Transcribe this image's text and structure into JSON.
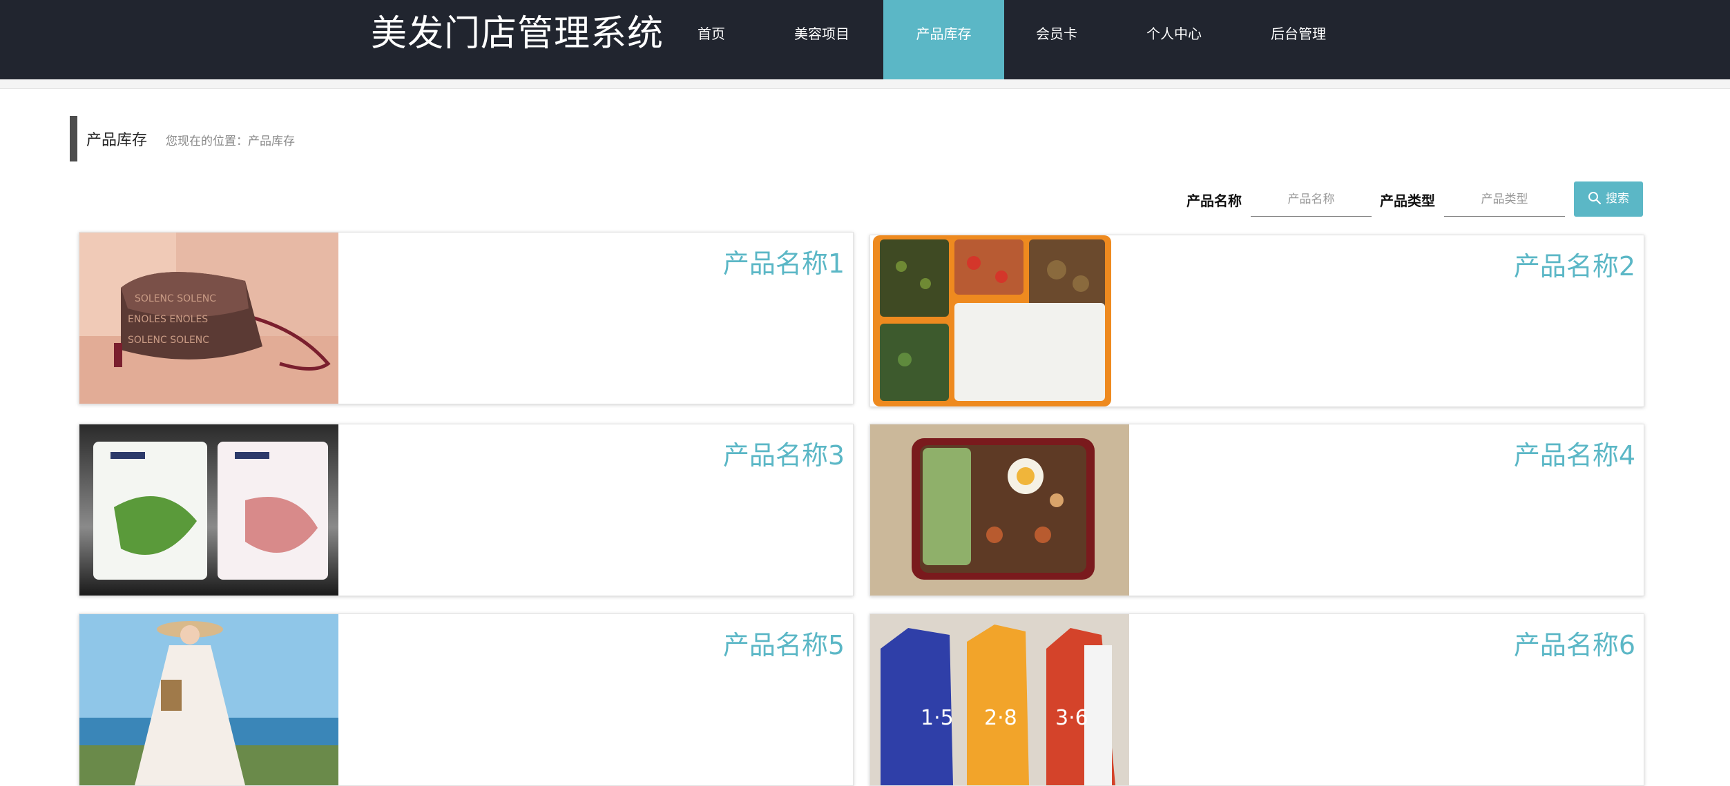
{
  "header": {
    "title": "美发门店管理系统",
    "nav": [
      "首页",
      "美容项目",
      "产品库存",
      "会员卡",
      "个人中心",
      "后台管理"
    ],
    "active_index": 2
  },
  "breadcrumb": {
    "title": "产品库存",
    "location": "您现在的位置：产品库存"
  },
  "search": {
    "name_label": "产品名称",
    "name_placeholder": "产品名称",
    "type_label": "产品类型",
    "type_placeholder": "产品类型",
    "button_label": "搜索"
  },
  "products": [
    {
      "name": "产品名称1"
    },
    {
      "name": "产品名称2"
    },
    {
      "name": "产品名称3"
    },
    {
      "name": "产品名称4"
    },
    {
      "name": "产品名称5"
    },
    {
      "name": "产品名称6"
    }
  ],
  "colors": {
    "header_bg": "#21252f",
    "accent": "#5bb7c6"
  }
}
